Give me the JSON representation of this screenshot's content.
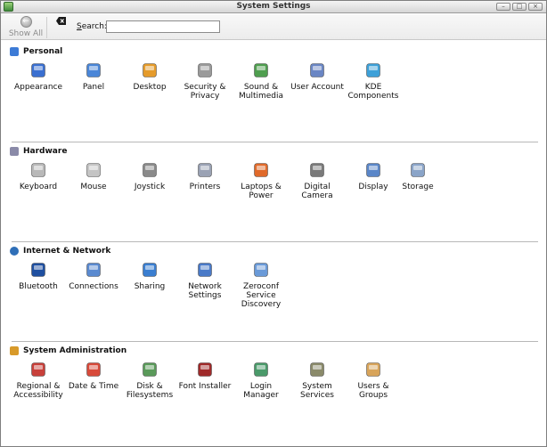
{
  "window": {
    "title": "System Settings"
  },
  "toolbar": {
    "show_all": "Show All",
    "search_label_first": "S",
    "search_label_rest": "earch:",
    "search_value": "",
    "search_placeholder": ""
  },
  "sections": [
    {
      "title": "Personal",
      "color": "#3d7bd6",
      "items": [
        {
          "label": "Appearance",
          "icon": "appearance-icon",
          "color": "#3a6fd0"
        },
        {
          "label": "Panel",
          "icon": "panel-icon",
          "color": "#4a86d8"
        },
        {
          "label": "Desktop",
          "icon": "desktop-icon",
          "color": "#e59b2b"
        },
        {
          "label": "Security &\nPrivacy",
          "icon": "keys-icon",
          "color": "#9a9a9a"
        },
        {
          "label": "Sound &\nMultimedia",
          "icon": "speaker-icon",
          "color": "#4f9e4f"
        },
        {
          "label": "User Account",
          "icon": "id-card-icon",
          "color": "#6a86c4"
        },
        {
          "label": "KDE\nComponents",
          "icon": "components-icon",
          "color": "#3da0d8"
        }
      ]
    },
    {
      "title": "Hardware",
      "color": "#8a8aa8",
      "items": [
        {
          "label": "Keyboard",
          "icon": "keyboard-icon",
          "color": "#b8b8b8"
        },
        {
          "label": "Mouse",
          "icon": "mouse-icon",
          "color": "#c4c4c4"
        },
        {
          "label": "Joystick",
          "icon": "joystick-icon",
          "color": "#8a8a8a"
        },
        {
          "label": "Printers",
          "icon": "printer-icon",
          "color": "#9aa2b4"
        },
        {
          "label": "Laptops &\nPower",
          "icon": "battery-icon",
          "color": "#e06a2a"
        },
        {
          "label": "Digital Camera",
          "icon": "camera-icon",
          "color": "#7a7a7a"
        },
        {
          "label": "Display",
          "icon": "monitor-icon",
          "color": "#5a86c8"
        },
        {
          "label": "Storage",
          "icon": "storage-icon",
          "color": "#8aa4c8"
        }
      ]
    },
    {
      "title": "Internet & Network",
      "color": "#2f6fb8",
      "items": [
        {
          "label": "Bluetooth",
          "icon": "bluetooth-icon",
          "color": "#1f4fa0"
        },
        {
          "label": "Connections",
          "icon": "connections-icon",
          "color": "#5a8ad0"
        },
        {
          "label": "Sharing",
          "icon": "sharing-icon",
          "color": "#3a7ed0"
        },
        {
          "label": "Network\nSettings",
          "icon": "network-icon",
          "color": "#4a7ac8"
        },
        {
          "label": "Zeroconf\nService\nDiscovery",
          "icon": "zeroconf-icon",
          "color": "#6a9ad8"
        }
      ]
    },
    {
      "title": "System Administration",
      "color": "#d89a2a",
      "items": [
        {
          "label": "Regional &\nAccessibility",
          "icon": "flag-icon",
          "color": "#c8403a"
        },
        {
          "label": "Date & Time",
          "icon": "calendar-icon",
          "color": "#d84a3a"
        },
        {
          "label": "Disk &\nFilesystems",
          "icon": "disk-icon",
          "color": "#5a9a5a"
        },
        {
          "label": "Font Installer",
          "icon": "font-icon",
          "color": "#a02a2a"
        },
        {
          "label": "Login Manager",
          "icon": "login-users-icon",
          "color": "#4a9a6a"
        },
        {
          "label": "System\nServices",
          "icon": "traffic-light-icon",
          "color": "#8a8a6a"
        },
        {
          "label": "Users &\nGroups",
          "icon": "users-icon",
          "color": "#d8a45a"
        }
      ]
    }
  ]
}
